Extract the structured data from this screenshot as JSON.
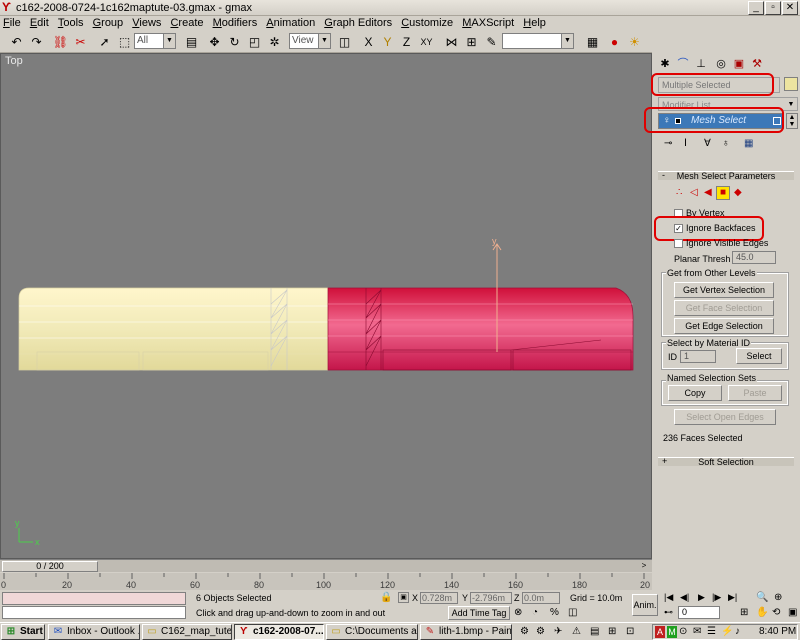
{
  "window": {
    "title": "c162-2008-0724-1c162maptute-03.gmax - gmax",
    "app_icon": "gmax-icon",
    "controls": [
      "_",
      "▫",
      "✕"
    ]
  },
  "menu": [
    "File",
    "Edit",
    "Tools",
    "Group",
    "Views",
    "Create",
    "Modifiers",
    "Animation",
    "Graph Editors",
    "Customize",
    "MAXScript",
    "Help"
  ],
  "toolbar": {
    "selection_filter": "All",
    "ref_coord": "View",
    "named_selection": ""
  },
  "viewport": {
    "label": "Top",
    "colors": {
      "background": "#7d7d7d",
      "left_object": "#f4efc0",
      "right_object": "#e0205a",
      "grid": "#a0a0a0"
    }
  },
  "panel": {
    "object_name_placeholder": "Multiple Selected",
    "modifier_list": "Modifier List",
    "stack_item": "Mesh Select",
    "rollout_title": "Mesh Select Parameters",
    "by_vertex": "By Vertex",
    "ignore_backfaces": "Ignore Backfaces",
    "ignore_visible_edges": "Ignore Visible Edges",
    "planar_thresh_label": "Planar Thresh",
    "planar_thresh_value": "45.0",
    "get_from_other_levels": "Get from Other Levels",
    "get_vertex_selection": "Get Vertex Selection",
    "get_face_selection": "Get Face Selection",
    "get_edge_selection": "Get Edge Selection",
    "select_by_material": "Select by Material ID",
    "id_label": "ID",
    "id_value": "1",
    "select_button": "Select",
    "named_sets": "Named Selection Sets",
    "copy": "Copy",
    "paste": "Paste",
    "select_open_edges": "Select Open Edges",
    "faces_selected": "236 Faces Selected",
    "soft_selection": "Soft Selection",
    "annotation_color": "#e00000"
  },
  "timeline": {
    "frame_display": "0 / 200",
    "ticks": [
      "0",
      "20",
      "40",
      "60",
      "80",
      "100",
      "120",
      "140",
      "160",
      "180",
      "20"
    ]
  },
  "status": {
    "objects_selected": "6 Objects Selected",
    "prompt": "Click and drag up-and-down to zoom in and out",
    "x_label": "X",
    "x_value": "0.728m",
    "y_label": "Y",
    "y_value": "-2.796m",
    "z_label": "Z",
    "z_value": "0.0m",
    "grid": "Grid = 10.0m",
    "add_time_tag": "Add Time Tag",
    "anim": "Anim.",
    "frame": "0"
  },
  "taskbar": {
    "start": "Start",
    "items": [
      "Inbox - Outlook ...",
      "C162_map_tute",
      "c162-2008-07...",
      "C:\\Documents a...",
      "lith-1.bmp - Paint"
    ],
    "clock": "8:40 PM"
  }
}
